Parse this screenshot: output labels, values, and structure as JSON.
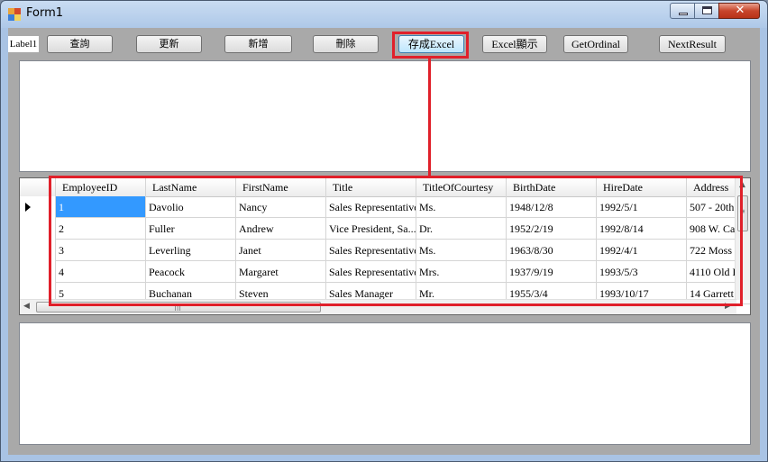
{
  "window": {
    "title": "Form1"
  },
  "toolbar": {
    "label": "Label1",
    "buttons": [
      "查詢",
      "更新",
      "新增",
      "刪除",
      "存成Excel",
      "Excel顯示",
      "GetOrdinal",
      "NextResult"
    ]
  },
  "grid": {
    "columns": [
      "EmployeeID",
      "LastName",
      "FirstName",
      "Title",
      "TitleOfCourtesy",
      "BirthDate",
      "HireDate",
      "Address"
    ],
    "rows": [
      [
        "1",
        "Davolio",
        "Nancy",
        "Sales Representative",
        "Ms.",
        "1948/12/8",
        "1992/5/1",
        "507 - 20th"
      ],
      [
        "2",
        "Fuller",
        "Andrew",
        "Vice President, Sa...",
        "Dr.",
        "1952/2/19",
        "1992/8/14",
        "908 W. Ca"
      ],
      [
        "3",
        "Leverling",
        "Janet",
        "Sales Representative",
        "Ms.",
        "1963/8/30",
        "1992/4/1",
        "722 Moss B"
      ],
      [
        "4",
        "Peacock",
        "Margaret",
        "Sales Representative",
        "Mrs.",
        "1937/9/19",
        "1993/5/3",
        "4110 Old R"
      ],
      [
        "5",
        "Buchanan",
        "Steven",
        "Sales Manager",
        "Mr.",
        "1955/3/4",
        "1993/10/17",
        "14 Garrett"
      ]
    ]
  },
  "colors": {
    "highlight": "#e0202a",
    "selection": "#3399ff"
  }
}
